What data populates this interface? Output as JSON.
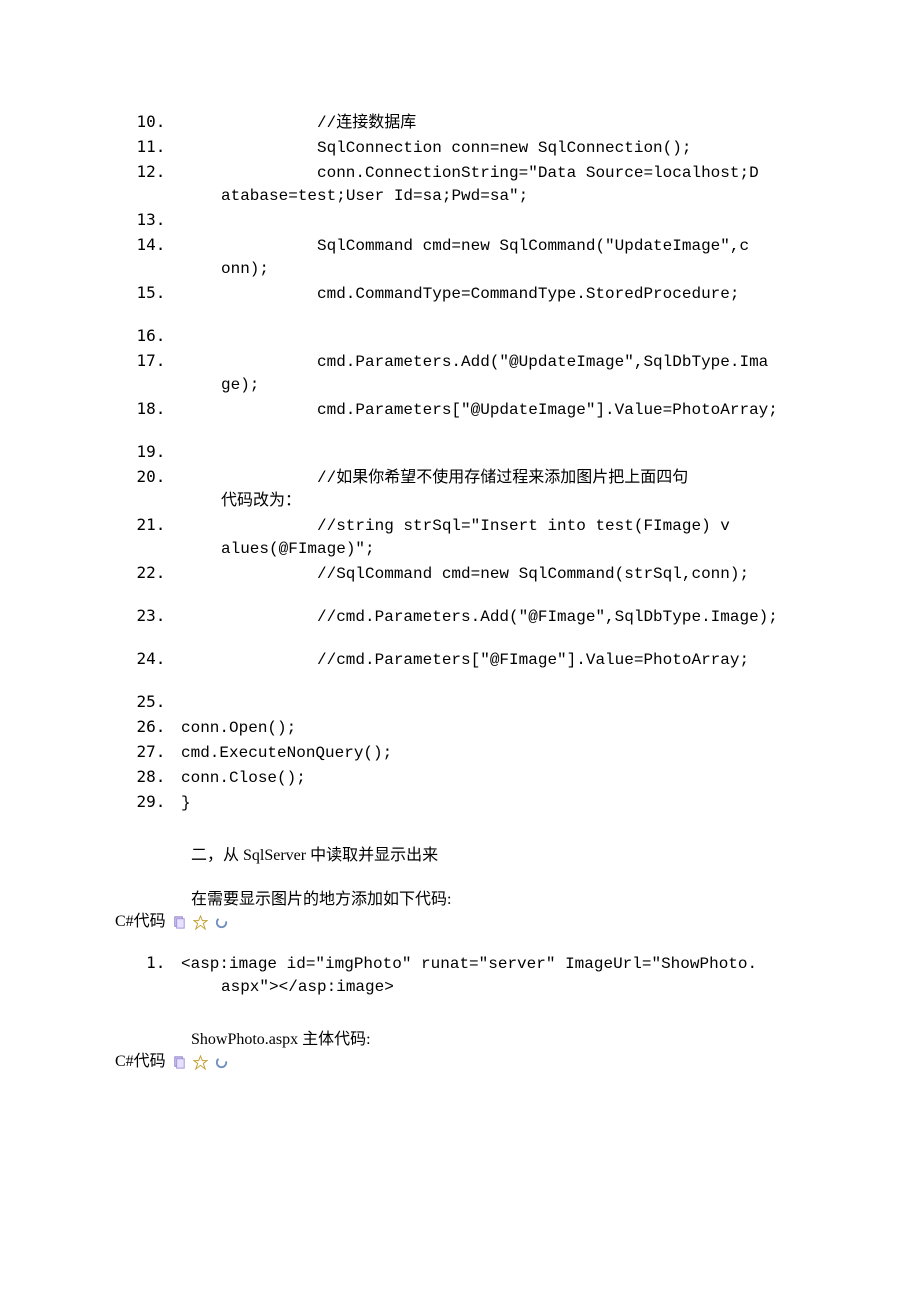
{
  "block1": {
    "start": 10,
    "lines": [
      "                //连接数据库",
      "                SqlConnection  conn=new  SqlConnection();",
      "                conn.ConnectionString=\"Data  Source=localhost;Database=test;User  Id=sa;Pwd=sa\";",
      "",
      "                SqlCommand  cmd=new  SqlCommand(\"UpdateImage\",conn);",
      "                cmd.CommandType=CommandType.StoredProcedure;  ",
      "",
      "                cmd.Parameters.Add(\"@UpdateImage\",SqlDbType.Image);",
      "                cmd.Parameters[\"@UpdateImage\"].Value=PhotoArray;  ",
      "",
      "                //如果你希望不使用存储过程来添加图片把上面四句代码改为：",
      "                //string  strSql=\"Insert  into  test(FImage)  values(@FImage)\";",
      "                //SqlCommand  cmd=new  SqlCommand(strSql,conn);  ",
      "                //cmd.Parameters.Add(\"@FImage\",SqlDbType.Image);  ",
      "                //cmd.Parameters[\"@FImage\"].Value=PhotoArray;  ",
      "",
      "conn.Open();",
      "cmd.ExecuteNonQuery();",
      "conn.Close();",
      "}"
    ]
  },
  "section_title": "二，从 SqlServer 中读取并显示出来",
  "para_add_code": "在需要显示图片的地方添加如下代码:",
  "csharp_label": "C#代码",
  "block2": {
    "start": 1,
    "lines": [
      "<asp:image  id=\"imgPhoto\"  runat=\"server\"  ImageUrl=\"ShowPhoto.aspx\"></asp:image>"
    ]
  },
  "para_showphoto": "ShowPhoto.aspx 主体代码:"
}
